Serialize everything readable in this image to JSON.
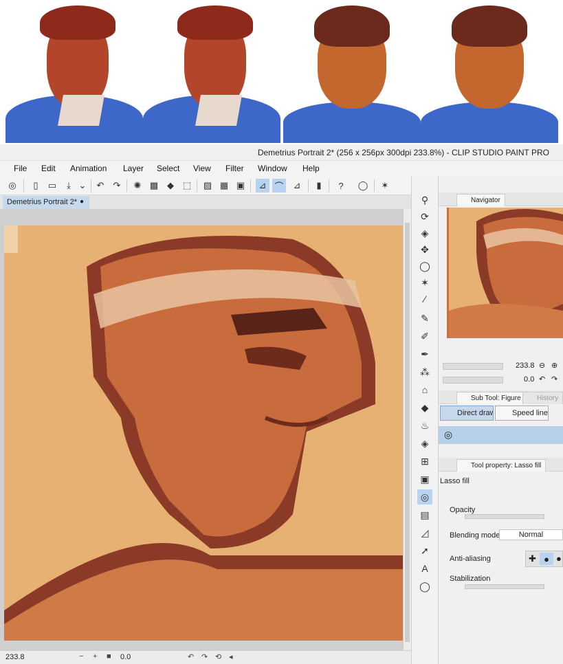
{
  "window": {
    "title": "Demetrius Portrait 2* (256 x 256px 300dpi 233.8%)  - CLIP STUDIO PAINT PRO"
  },
  "menu": [
    "File",
    "Edit",
    "Animation",
    "Layer",
    "Select",
    "View",
    "Filter",
    "Window",
    "Help"
  ],
  "document_tab": {
    "label": "Demetrius Portrait 2*",
    "modified_dot": "●"
  },
  "status": {
    "zoom": "233.8",
    "angle": "0.0"
  },
  "navigator": {
    "tab_label": "Navigator",
    "zoom_value": "233.8",
    "rotation_value": "0.0"
  },
  "subtool": {
    "tab_label": "Sub Tool: Figure",
    "history_tab": "History",
    "items": [
      "Direct draw",
      "Speed line"
    ]
  },
  "tool_property": {
    "tab_label": "Tool property: Lasso fill",
    "tool_name": "Lasso fill",
    "opacity_label": "Opacity",
    "blending_label": "Blending mode",
    "blending_value": "Normal",
    "antialias_label": "Anti-aliasing",
    "stabilization_label": "Stabilization"
  },
  "colors": {
    "accent": "#b7d3ef",
    "canvas_bg": "#e6b173",
    "skin_dark": "#7a2e1c",
    "shirt_blue": "#3d67c9"
  }
}
